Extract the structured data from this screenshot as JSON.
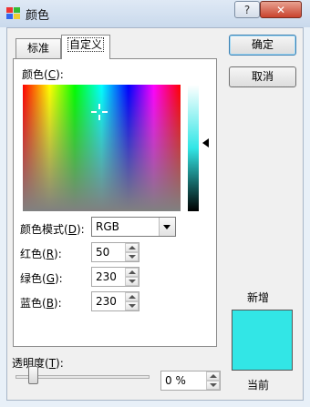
{
  "window": {
    "title": "颜色",
    "help_label": "?",
    "close_label": "✕"
  },
  "tabs": [
    {
      "label": "标准",
      "selected": false
    },
    {
      "label": "自定义",
      "selected": true
    }
  ],
  "colors_label": {
    "text": "颜色(",
    "key": "C",
    "suffix": "):"
  },
  "color_model": {
    "label": "颜色模式(",
    "key": "D",
    "suffix": "):",
    "value": "RGB"
  },
  "red": {
    "label": "红色(",
    "key": "R",
    "suffix": "):",
    "value": "50"
  },
  "green": {
    "label": "绿色(",
    "key": "G",
    "suffix": "):",
    "value": "230"
  },
  "blue": {
    "label": "蓝色(",
    "key": "B",
    "suffix": "):",
    "value": "230"
  },
  "buttons": {
    "ok": "确定",
    "cancel": "取消"
  },
  "preview": {
    "new_label": "新增",
    "current_label": "当前",
    "color": "#32E6E6"
  },
  "transparency": {
    "label": "透明度(",
    "key": "T",
    "suffix": "):",
    "value": "0 %",
    "level": 0
  }
}
